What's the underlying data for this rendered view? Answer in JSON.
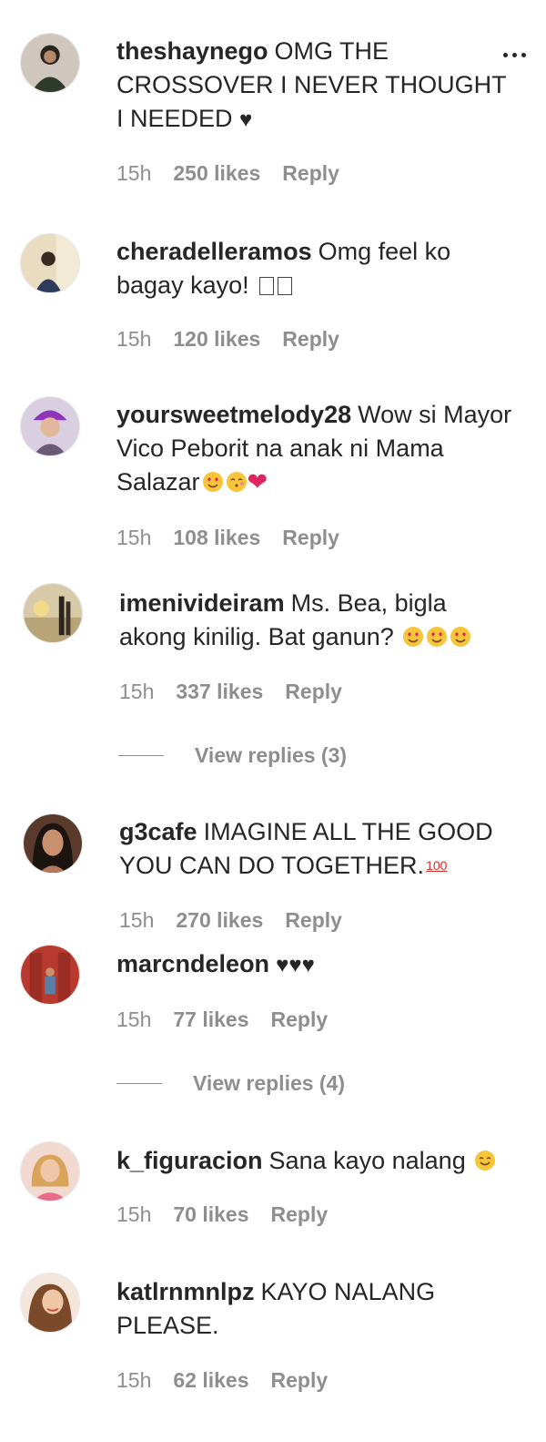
{
  "comments": [
    {
      "username": "theshaynego",
      "text": "OMG THE CROSSOVER I NEVER THOUGHT I NEEDED",
      "suffix": "♥",
      "time": "15h",
      "likes": "250 likes",
      "reply": "Reply"
    },
    {
      "username": "cheradelleramos",
      "text": "Omg feel ko bagay kayo!",
      "time": "15h",
      "likes": "120 likes",
      "reply": "Reply"
    },
    {
      "username": "yoursweetmelody28",
      "text": "Wow si Mayor Vico Peborit na anak ni Mama Salazar",
      "suffix": "❤",
      "time": "15h",
      "likes": "108 likes",
      "reply": "Reply"
    },
    {
      "username": "imenivideiram",
      "text": "Ms. Bea, bigla akong kinilig. Bat ganun?",
      "time": "15h",
      "likes": "337 likes",
      "reply": "Reply",
      "view_replies": "View replies (3)"
    },
    {
      "username": "g3cafe",
      "text": "IMAGINE ALL THE GOOD YOU CAN DO TOGETHER.",
      "suffix": "100",
      "time": "15h",
      "likes": "270 likes",
      "reply": "Reply"
    },
    {
      "username": "marcndeleon",
      "text": "♥♥♥",
      "time": "15h",
      "likes": "77 likes",
      "reply": "Reply",
      "view_replies": "View replies (4)"
    },
    {
      "username": "k_figuracion",
      "text": "Sana kayo nalang",
      "time": "15h",
      "likes": "70 likes",
      "reply": "Reply"
    },
    {
      "username": "katlrnmnlpz",
      "text": "KAYO NALANG PLEASE.",
      "time": "15h",
      "likes": "62 likes",
      "reply": "Reply"
    }
  ],
  "icons": {
    "more": "more-options-icon",
    "emoji_heart_eyes": "heart-eyes-emoji",
    "emoji_kiss": "kissing-face-emoji",
    "emoji_smile": "smiling-face-emoji"
  },
  "colors": {
    "text": "#262626",
    "muted": "#8e8e8e",
    "red_heart": "#e0245e"
  }
}
